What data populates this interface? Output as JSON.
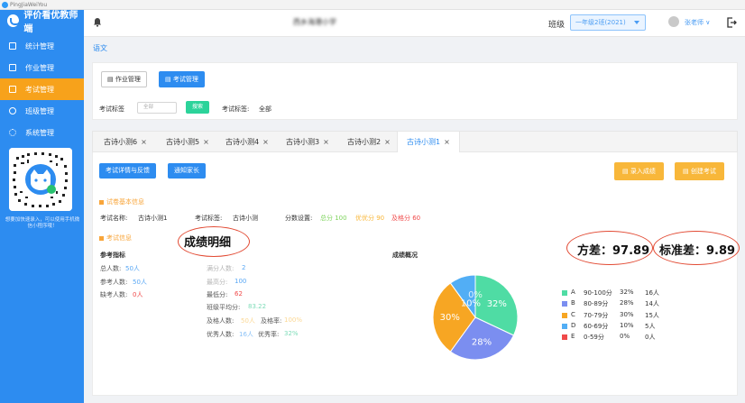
{
  "window": {
    "title": "PingJiaWeiYou"
  },
  "app": {
    "name": "评价看优教师端"
  },
  "sidebar": {
    "items": [
      {
        "label": "统计管理",
        "icon": "stats-icon",
        "active": false
      },
      {
        "label": "作业管理",
        "icon": "homework-icon",
        "active": false
      },
      {
        "label": "考试管理",
        "icon": "exam-icon",
        "active": true
      },
      {
        "label": "班级管理",
        "icon": "class-icon",
        "active": false
      },
      {
        "label": "系统管理",
        "icon": "settings-icon",
        "active": false
      }
    ],
    "qr_tip": "想要加快速录入，可以使用手机微信小程序哦！"
  },
  "header": {
    "school": "西乡海港小学",
    "class_label": "班级",
    "class_value": "一年级2班(2021)",
    "user": "张老师 ∨"
  },
  "breadcrumb": "语文",
  "toolbar": {
    "homework_btn": "作业管理",
    "exam_btn": "考试管理",
    "tag_label": "考试标签",
    "tag_select": "全部",
    "search_btn": "搜索",
    "tag_label2": "考试标签:",
    "tag_value2": "全部"
  },
  "tabs": [
    {
      "label": "古诗小测6",
      "active": false
    },
    {
      "label": "古诗小测5",
      "active": false
    },
    {
      "label": "古诗小测4",
      "active": false
    },
    {
      "label": "古诗小测3",
      "active": false
    },
    {
      "label": "古诗小测2",
      "active": false
    },
    {
      "label": "古诗小测1",
      "active": true
    }
  ],
  "actions": {
    "detail_btn": "考试详情与反馈",
    "notify_btn": "通知家长",
    "entry_btn": "录入成绩",
    "create_btn": "创建考试"
  },
  "basic": {
    "section": "试卷基本信息",
    "name_label": "考试名称:",
    "name_value": "古诗小测1",
    "tag_label": "考试标签:",
    "tag_value": "古诗小测",
    "score_label": "分数设置:",
    "full": "总分 100",
    "excellent": "优优分 90",
    "pass": "及格分 60"
  },
  "info": {
    "section": "考试信息",
    "ref_title": "参考指标",
    "total_label": "总人数:",
    "total": "50人",
    "participants_label": "参考人数:",
    "participants": "50人",
    "absent_label": "缺考人数:",
    "absent": "0人",
    "full_count_label": "满分人数:",
    "full_count": "2",
    "highest_label": "最高分:",
    "highest": "100",
    "lowest_label": "最低分:",
    "lowest": "62",
    "avg_label": "班级平均分:",
    "avg": "83.22",
    "pass_count_label": "及格人数:",
    "pass_count": "50人",
    "pass_rate_label": "及格率:",
    "pass_rate": "100%",
    "excel_count_label": "优秀人数:",
    "excel_count": "16人",
    "excel_rate_label": "优秀率:",
    "excel_rate": "32%",
    "overview_title": "成绩概况"
  },
  "annotations": {
    "detail": "成绩明细",
    "variance": "方差：97.89",
    "std": "标准差：9.89"
  },
  "chart_data": {
    "type": "pie",
    "title": "成绩概况",
    "series": [
      {
        "name": "A",
        "range": "90-100分",
        "percent": 32,
        "count": "16人",
        "color": "#4fdca4"
      },
      {
        "name": "B",
        "range": "80-89分",
        "percent": 28,
        "count": "14人",
        "color": "#7b8ef0"
      },
      {
        "name": "C",
        "range": "70-79分",
        "percent": 30,
        "count": "15人",
        "color": "#f7a623"
      },
      {
        "name": "D",
        "range": "60-69分",
        "percent": 10,
        "count": "5人",
        "color": "#52aef5"
      },
      {
        "name": "E",
        "range": "0-59分",
        "percent": 0,
        "count": "0人",
        "color": "#f04a4a"
      }
    ],
    "slice_labels": [
      "32%",
      "28%",
      "30%",
      "10%",
      "0%"
    ]
  }
}
